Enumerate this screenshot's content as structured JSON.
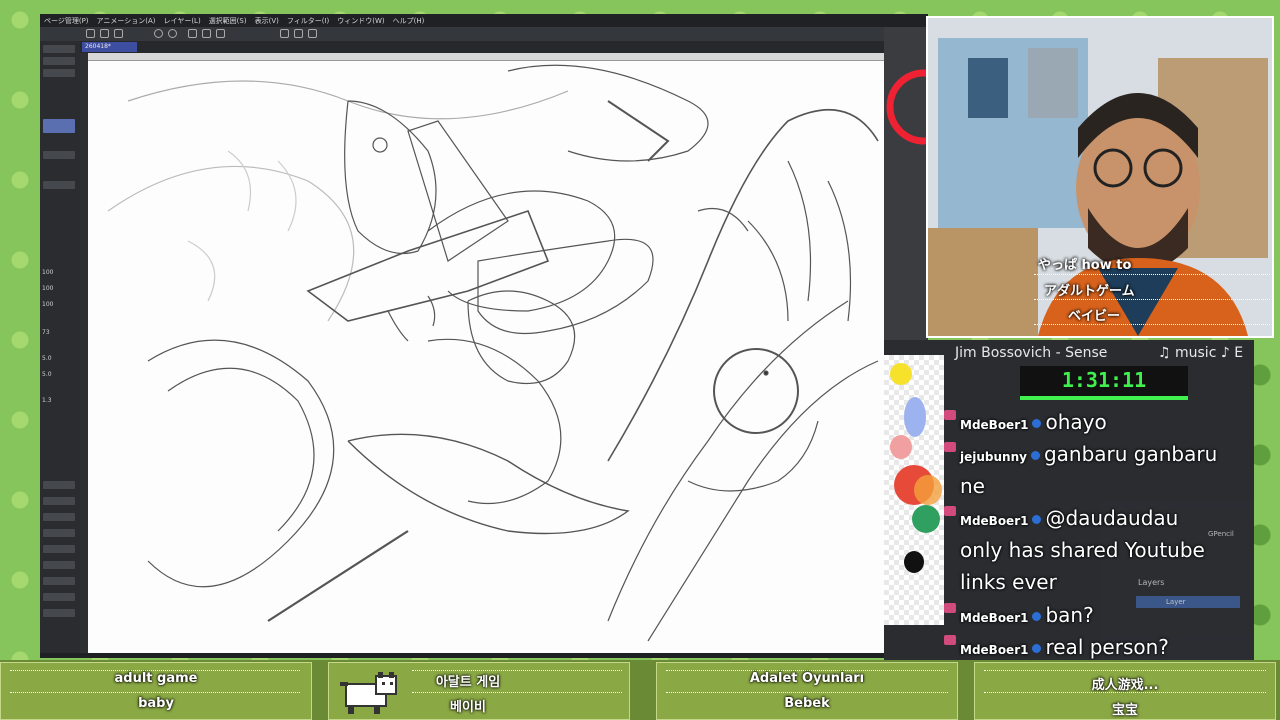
{
  "menu": [
    "ページ管理(P)",
    "アニメーション(A)",
    "レイヤー(L)",
    "選択範囲(S)",
    "表示(V)",
    "フィルター(I)",
    "ウィンドウ(W)",
    "ヘルプ(H)"
  ],
  "canvas_tab": "260418*",
  "left_panel": {
    "values": [
      "100",
      "100",
      "100",
      "73",
      "5.0",
      "5.0",
      "1.3"
    ]
  },
  "webcam_subtitles": [
    "やっぱ how to",
    "アダルトゲーム",
    "ベイビー"
  ],
  "now_playing": "Jim Bossovich - Sense",
  "music_label": "♫ music ♪ E",
  "timer": "1:31:11",
  "timer_progress": 1.0,
  "chat": [
    {
      "user": "MdeBoer1",
      "text": "ohayo"
    },
    {
      "user": "jejubunny",
      "text": "ganbaru ganbaru"
    },
    {
      "user": "",
      "text": "ne"
    },
    {
      "user": "MdeBoer1",
      "text": "@daudaudau"
    },
    {
      "user": "",
      "text": "only has shared Youtube"
    },
    {
      "user": "",
      "text": "links ever"
    },
    {
      "user": "MdeBoer1",
      "text": "ban?"
    },
    {
      "user": "MdeBoer1",
      "text": "real person?"
    }
  ],
  "blender": {
    "layers_label": "Layers",
    "layer_name": "Layer",
    "gpencil": "GPencil"
  },
  "bottom_subtitles": [
    {
      "line1": "adult game",
      "line2": "baby"
    },
    {
      "line1": "아달트 게임",
      "line2": "베이비"
    },
    {
      "line1": "Adalet Oyunları",
      "line2": "Bebek"
    },
    {
      "line1": "成人游戏...",
      "line2": "宝宝"
    }
  ],
  "colors": {
    "accent": "#3ff04f",
    "badge": "#2b6fd6",
    "tab": "#3d4ea0"
  }
}
